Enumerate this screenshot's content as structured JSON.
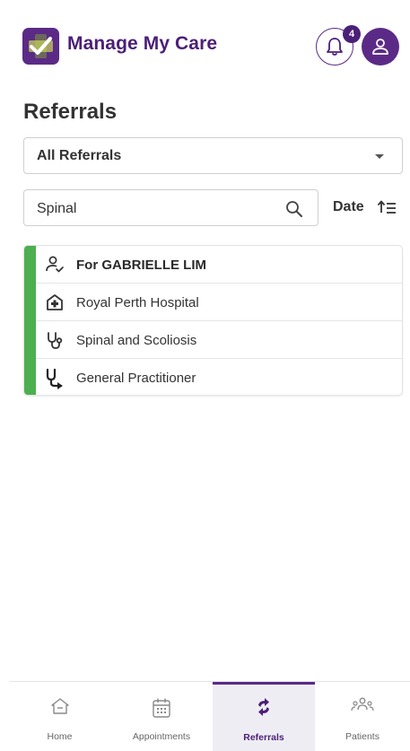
{
  "app": {
    "title": "Manage My Care",
    "notification_count": "4",
    "brand_color": "#5b2a86",
    "accent_green": "#4caf50"
  },
  "page": {
    "title": "Referrals"
  },
  "filter": {
    "selected": "All Referrals"
  },
  "search": {
    "value": "Spinal"
  },
  "sort": {
    "label": "Date"
  },
  "referral_card": {
    "rows": [
      {
        "icon": "person-check-icon",
        "text": "For GABRIELLE LIM"
      },
      {
        "icon": "hospital-icon",
        "text": "Royal Perth Hospital"
      },
      {
        "icon": "stethoscope-icon",
        "text": "Spinal and Scoliosis"
      },
      {
        "icon": "stethoscope-arrow-icon",
        "text": "General Practitioner"
      }
    ]
  },
  "nav": {
    "items": [
      {
        "label": "Home",
        "icon": "home-icon"
      },
      {
        "label": "Appointments",
        "icon": "calendar-icon"
      },
      {
        "label": "Referrals",
        "icon": "referrals-icon",
        "active": true
      },
      {
        "label": "Patients",
        "icon": "patients-icon"
      }
    ]
  }
}
